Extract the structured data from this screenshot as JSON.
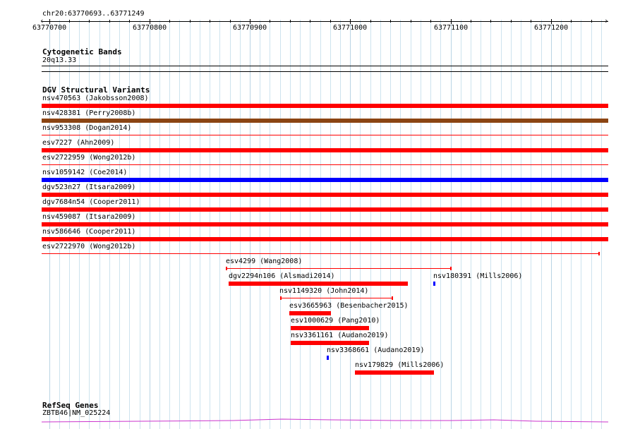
{
  "ruler": {
    "label": "chr20:63770693..63771249",
    "ticks": [
      {
        "label": "63770700",
        "pos": 63770700
      },
      {
        "label": "63770800",
        "pos": 63770800
      },
      {
        "label": "63770900",
        "pos": 63770900
      },
      {
        "label": "63771000",
        "pos": 63771000
      },
      {
        "label": "63771100",
        "pos": 63771100
      },
      {
        "label": "63771200",
        "pos": 63771200
      }
    ]
  },
  "cytobands": {
    "title": "Cytogenetic Bands",
    "band": "20q13.33"
  },
  "dgv": {
    "title": "DGV Structural Variants",
    "features": [
      {
        "label": "nsv470563 (Jakobsson2008)",
        "color": "#ff0000",
        "style": "thick"
      },
      {
        "label": "nsv428381 (Perry2008b)",
        "color": "#8b4513",
        "style": "thick"
      },
      {
        "label": "nsv953308 (Dogan2014)",
        "color": "#ff0000",
        "style": "thin"
      },
      {
        "label": "esv7227 (Ahn2009)",
        "color": "#ff0000",
        "style": "thick"
      },
      {
        "label": "esv2722959 (Wong2012b)",
        "color": "#ff0000",
        "style": "thin"
      },
      {
        "label": "nsv1059142 (Coe2014)",
        "color": "#0000ff",
        "style": "thick"
      },
      {
        "label": "dgv523n27 (Itsara2009)",
        "color": "#ff0000",
        "style": "thick"
      },
      {
        "label": "dgv7684n54 (Cooper2011)",
        "color": "#ff0000",
        "style": "thick"
      },
      {
        "label": "nsv459087 (Itsara2009)",
        "color": "#ff0000",
        "style": "thick"
      },
      {
        "label": "nsv586646 (Cooper2011)",
        "color": "#ff0000",
        "style": "thick"
      },
      {
        "label": "esv2722970 (Wong2012b)",
        "color": "#ff0000",
        "style": "thin-end"
      },
      {
        "label": "esv4299 (Wang2008)",
        "color": "#ff0000",
        "style": "thin-both"
      },
      {
        "label": "dgv2294n106 (Alsmadi2014)",
        "color": "#ff0000",
        "style": "thick"
      },
      {
        "label": "nsv180391 (Mills2006)",
        "color": "#0000ff",
        "style": "dot"
      },
      {
        "label": "nsv1149320 (John2014)",
        "color": "#ff0000",
        "style": "thin-both"
      },
      {
        "label": "esv3665963 (Besenbacher2015)",
        "color": "#ff0000",
        "style": "thick"
      },
      {
        "label": "esv1000629 (Pang2010)",
        "color": "#ff0000",
        "style": "thick"
      },
      {
        "label": "nsv3361161 (Audano2019)",
        "color": "#ff0000",
        "style": "thick"
      },
      {
        "label": "nsv3368661 (Audano2019)",
        "color": "#0000ff",
        "style": "dot"
      },
      {
        "label": "nsv179829 (Mills2006)",
        "color": "#ff0000",
        "style": "thick"
      }
    ]
  },
  "refseq": {
    "title": "RefSeq Genes",
    "gene": "ZBTB46|NM_025224",
    "color": "#cc33cc"
  }
}
